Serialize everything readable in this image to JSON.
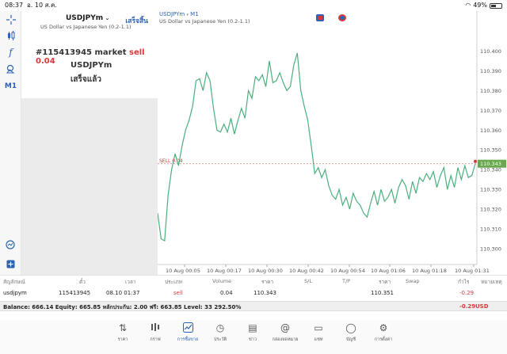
{
  "status": {
    "time": "08:37",
    "date": "อ. 10 ส.ค.",
    "battery": "49%"
  },
  "order": {
    "symbol": "USDJPYm",
    "symbol_desc": "US Dollar vs Japanese Yen (0.2-1.1)",
    "done_label": "เสร็จสิ้น",
    "result_prefix": "#115413945 market",
    "result_action": "sell 0.04",
    "result_symbol": "USDJPYm",
    "result_status": "เสร็จแล้ว"
  },
  "chart_header": {
    "symbol": "USDJPYm",
    "timeframe": "M1",
    "description": "US Dollar vs Japanese Yen (0.2-1.1)"
  },
  "chart_data": {
    "type": "line",
    "ylim": [
      110.292,
      110.413
    ],
    "yticks": [
      "110.400",
      "110.390",
      "110.380",
      "110.370",
      "110.360",
      "110.350",
      "110.340",
      "110.330",
      "110.320",
      "110.310",
      "110.300"
    ],
    "xticks": [
      "10 Aug 00:05",
      "10 Aug 00:17",
      "10 Aug 00:30",
      "10 Aug 00:42",
      "10 Aug 00:54",
      "10 Aug 01:06",
      "10 Aug 01:18",
      "10 Aug 01:31"
    ],
    "current_price": "110.343",
    "order_line_label": "SELL 0.04",
    "order_line_price": 110.343,
    "series": [
      {
        "values": [
          110.318,
          110.305,
          110.304,
          110.327,
          110.34,
          110.348,
          110.342,
          110.352,
          110.36,
          110.365,
          110.372,
          110.385,
          110.386,
          110.38,
          110.389,
          110.385,
          110.371,
          110.36,
          110.359,
          110.363,
          110.359,
          110.366,
          110.358,
          110.365,
          110.371,
          110.366,
          110.38,
          110.376,
          110.387,
          110.385,
          110.388,
          110.382,
          110.395,
          110.384,
          110.385,
          110.389,
          110.384,
          110.38,
          110.382,
          110.393,
          110.399,
          110.38,
          110.372,
          110.365,
          110.352,
          110.338,
          110.341,
          110.336,
          110.34,
          110.332,
          110.327,
          110.325,
          110.33,
          110.322,
          110.326,
          110.32,
          110.328,
          110.324,
          110.322,
          110.318,
          110.316,
          110.323,
          110.329,
          110.322,
          110.33,
          110.324,
          110.326,
          110.33,
          110.323,
          110.331,
          110.335,
          110.332,
          110.325,
          110.334,
          110.328,
          110.336,
          110.334,
          110.338,
          110.335,
          110.339,
          110.331,
          110.337,
          110.341,
          110.33,
          110.337,
          110.331,
          110.341,
          110.335,
          110.342,
          110.336,
          110.337,
          110.343
        ]
      }
    ]
  },
  "table": {
    "headers": [
      "สัญลักษณ์",
      "ตั๋ว",
      "เวลา",
      "ประเภท",
      "Volume",
      "ราคา",
      "S/L",
      "T/P",
      "ราคา",
      "Swap",
      "กำไร",
      "หมายเหตุ"
    ],
    "row": {
      "symbol": "usdjpym",
      "ticket": "115413945",
      "time": "08.10 01:37",
      "type": "sell",
      "volume": "0.04",
      "price": "110.343",
      "cur_price": "110.351",
      "profit": "-0.29"
    }
  },
  "balance": {
    "text": "Balance: 666.14 Equity: 665.85 หลักประกัน: 2.00 ฟรี: 663.85 Level: 33 292.50%",
    "profit": "-0.29",
    "currency": "USD"
  },
  "nav": {
    "items": [
      {
        "label": "ราคา",
        "icon": "quotes-icon"
      },
      {
        "label": "กราฟ",
        "icon": "chart-icon"
      },
      {
        "label": "การซื้อขาย",
        "icon": "trade-icon"
      },
      {
        "label": "ประวัติ",
        "icon": "history-icon"
      },
      {
        "label": "ข่าว",
        "icon": "news-icon"
      },
      {
        "label": "กล่องจดหมาย",
        "icon": "mailbox-icon"
      },
      {
        "label": "แชท",
        "icon": "chat-icon"
      },
      {
        "label": "บัญชี",
        "icon": "account-icon"
      },
      {
        "label": "การตั้งค่า",
        "icon": "settings-icon"
      }
    ]
  },
  "colors": {
    "accent": "#2d62b3",
    "sell": "#d9383a",
    "line": "#4caf7d",
    "price_badge": "#6aa84f"
  }
}
